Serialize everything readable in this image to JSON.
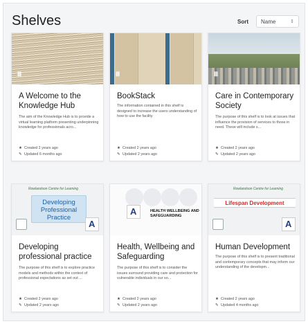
{
  "header": {
    "title": "Shelves",
    "sort_label": "Sort",
    "sort_value": "Name"
  },
  "shelves": [
    {
      "title": "A Welcome to the Knowledge Hub",
      "description": "The aim of the Knowledge Hub is to provide a virtual learning platform presenting underpinning knowledge for professionals acro...",
      "created": "Created 2 years ago",
      "updated": "Updated 6 months ago"
    },
    {
      "title": "BookStack",
      "description": "The information contained in this shelf is designed to increase the users understanding of how to use the facility",
      "created": "Created 2 years ago",
      "updated": "Updated 2 years ago"
    },
    {
      "title": "Care in Contemporary Society",
      "description": "The purpose of this shelf is to look at issues that influence the provision of services to those in need. These will include s...",
      "created": "Created 2 years ago",
      "updated": "Updated 2 years ago"
    },
    {
      "title": "Developing professional practice",
      "description": "The purpose of this shelf is to explore practice models and methods within the context of professional expectations as set out ...",
      "created": "Created 2 years ago",
      "updated": "Updated 2 years ago",
      "cover": {
        "header": "Rowlandson Centre for Learning",
        "headline": "Developing Professional Practice"
      }
    },
    {
      "title": "Health, Wellbeing and Safeguarding",
      "description": "The purpose of this shelf is to consider the issues surround providing care and protection for vulnerable individuals in our so...",
      "created": "Created 2 years ago",
      "updated": "Updated 2 years ago",
      "cover": {
        "headline": "HEALTH WELLBEING AND SAFEGUARDING"
      }
    },
    {
      "title": "Human Development",
      "description": "The purpose of this shelf is to present traditional and contemporary concepts that may inform our understanding of the developm...",
      "created": "Created 2 years ago",
      "updated": "Updated 4 months ago",
      "cover": {
        "header": "Rowlandson Centre for Learning",
        "headline": "Lifespan Development"
      }
    }
  ],
  "icons": {
    "created": "star-icon",
    "updated": "pencil-icon"
  },
  "colors": {
    "link_blue": "#1f5fa6",
    "accent_red": "#d42b2b"
  }
}
